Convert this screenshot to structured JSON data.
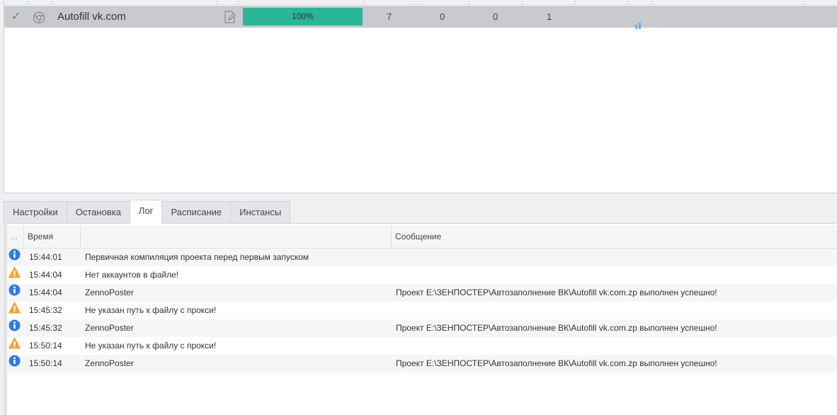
{
  "project": {
    "name": "Autofill vk.com",
    "progress_label": "100%",
    "progress": 100,
    "counts": [
      "7",
      "0",
      "0",
      "1"
    ],
    "status": "success"
  },
  "tabs": [
    "Настройки",
    "Остановка",
    "Лог",
    "Расписание",
    "Инстансы"
  ],
  "active_tab": "Лог",
  "log": {
    "headers": {
      "dots": "...",
      "time": "Время",
      "message": "Сообщение"
    },
    "rows": [
      {
        "type": "info",
        "time": "15:44:01",
        "source": "Первичная компиляция проекта перед первым запуском",
        "message": ""
      },
      {
        "type": "warning",
        "time": "15:44:04",
        "source": "Нет аккаунтов в файле!",
        "message": ""
      },
      {
        "type": "info",
        "time": "15:44:04",
        "source": "ZennoPoster",
        "message": "Проект E:\\ЗЕНПОСТЕР\\Автозаполнение ВК\\Autofill vk.com.zp выполнен успешно!"
      },
      {
        "type": "warning",
        "time": "15:45:32",
        "source": "Не указан путь к файлу с прокси!",
        "message": ""
      },
      {
        "type": "info",
        "time": "15:45:32",
        "source": "ZennoPoster",
        "message": "Проект E:\\ЗЕНПОСТЕР\\Автозаполнение ВК\\Autofill vk.com.zp выполнен успешно!"
      },
      {
        "type": "warning",
        "time": "15:50:14",
        "source": "Не указан путь к файлу с прокси!",
        "message": ""
      },
      {
        "type": "info",
        "time": "15:50:14",
        "source": "ZennoPoster",
        "message": "Проект E:\\ЗЕНПОСТЕР\\Автозаполнение ВК\\Autofill vk.com.zp выполнен успешно!"
      }
    ]
  },
  "colors": {
    "progress": "#2bb594",
    "info": "#2f7be0",
    "warning": "#f3a532",
    "check": "#2aa84a"
  }
}
